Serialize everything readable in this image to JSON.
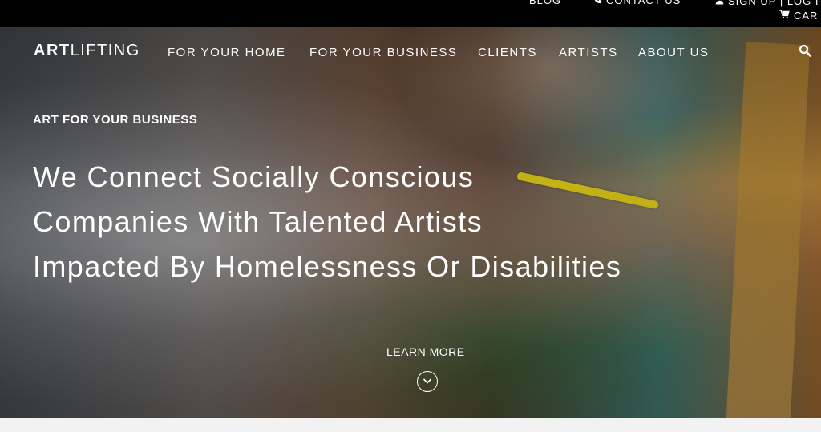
{
  "topbar": {
    "blog": "BLOG",
    "contact": "CONTACT US",
    "signup": "SIGN UP | LOG I",
    "cart": "CAR"
  },
  "brand": {
    "logo_bold": "ART",
    "logo_light": "LIFTING"
  },
  "nav": {
    "items": [
      "FOR YOUR HOME",
      "FOR YOUR BUSINESS",
      "CLIENTS",
      "ARTISTS",
      "ABOUT US"
    ]
  },
  "hero": {
    "eyebrow": "ART FOR YOUR BUSINESS",
    "headline_lines": [
      "We Connect Socially Conscious",
      "Companies With Talented Artists",
      "Impacted By Homelessness Or Disabilities"
    ],
    "cta": "LEARN MORE"
  },
  "icons": {
    "phone": "phone-icon",
    "user": "user-icon",
    "cart": "cart-icon",
    "search": "search-icon",
    "chevron": "chevron-down-icon"
  },
  "colors": {
    "topbar_bg": "#000000",
    "text": "#ffffff"
  }
}
